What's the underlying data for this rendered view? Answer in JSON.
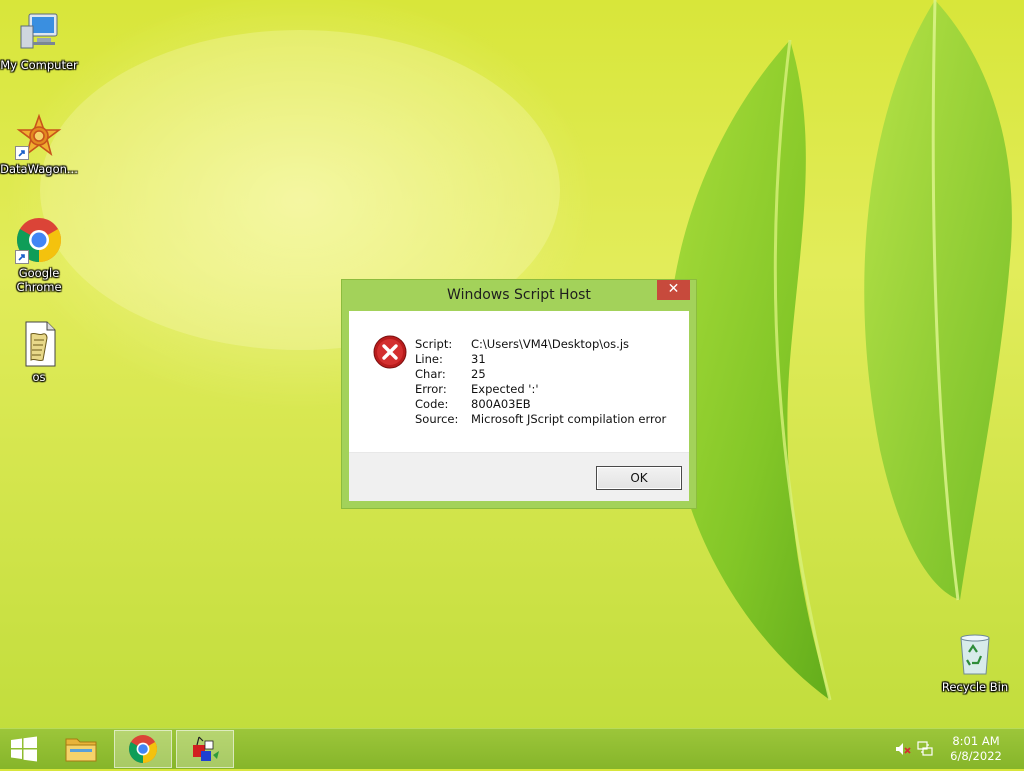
{
  "desktop": {
    "icons": [
      {
        "label": "My Computer",
        "icon": "computer-icon"
      },
      {
        "label": "DataWagon...",
        "icon": "datawagon-icon",
        "shortcut": true
      },
      {
        "label": "Google\nChrome",
        "icon": "chrome-icon",
        "shortcut": true
      },
      {
        "label": "os",
        "icon": "script-file-icon"
      },
      {
        "label": "Recycle Bin",
        "icon": "recycle-bin-icon"
      }
    ]
  },
  "dialog": {
    "title": "Windows Script Host",
    "close_glyph": "✕",
    "fields": [
      {
        "key": "Script:",
        "value": "C:\\Users\\VM4\\Desktop\\os.js"
      },
      {
        "key": "Line:",
        "value": "31"
      },
      {
        "key": "Char:",
        "value": "25"
      },
      {
        "key": "Error:",
        "value": "Expected ':'"
      },
      {
        "key": "Code:",
        "value": "800A03EB"
      },
      {
        "key": "Source:",
        "value": "Microsoft JScript compilation error"
      }
    ],
    "ok_label": "OK",
    "accent_color": "#a3d25a",
    "close_color": "#c74a3c"
  },
  "taskbar": {
    "items": [
      {
        "name": "start",
        "icon": "windows-logo-icon"
      },
      {
        "name": "file-explorer",
        "icon": "folder-icon"
      },
      {
        "name": "chrome",
        "icon": "chrome-icon",
        "active": true
      },
      {
        "name": "script-host",
        "icon": "script-host-icon",
        "active": true
      }
    ],
    "tray": {
      "time": "8:01 AM",
      "date": "6/8/2022",
      "icons": [
        "speaker-muted-icon",
        "network-icon"
      ]
    }
  }
}
